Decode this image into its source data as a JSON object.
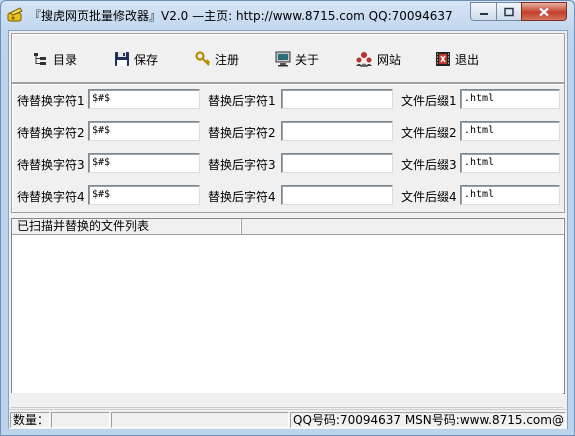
{
  "window": {
    "title": "『搜虎网页批量修改器』V2.0 —主页: http://www.8715.com QQ:70094637"
  },
  "toolbar": {
    "items": [
      {
        "label": "目录",
        "icon": "folder-tree-icon"
      },
      {
        "label": "保存",
        "icon": "floppy-disk-icon"
      },
      {
        "label": "注册",
        "icon": "key-icon"
      },
      {
        "label": "关于",
        "icon": "computer-monitor-icon"
      },
      {
        "label": "网站",
        "icon": "people-network-icon"
      },
      {
        "label": "退出",
        "icon": "exit-film-icon"
      }
    ]
  },
  "form": {
    "rows": [
      {
        "find_label": "待替换字符1",
        "find_value": "$#$",
        "replace_label": "替换后字符1",
        "replace_value": "",
        "ext_label": "文件后缀1",
        "ext_value": ".html"
      },
      {
        "find_label": "待替换字符2",
        "find_value": "$#$",
        "replace_label": "替换后字符2",
        "replace_value": "",
        "ext_label": "文件后缀2",
        "ext_value": ".html"
      },
      {
        "find_label": "待替换字符3",
        "find_value": "$#$",
        "replace_label": "替换后字符3",
        "replace_value": "",
        "ext_label": "文件后缀3",
        "ext_value": ".html"
      },
      {
        "find_label": "待替换字符4",
        "find_value": "$#$",
        "replace_label": "替换后字符4",
        "replace_value": "",
        "ext_label": "文件后缀4",
        "ext_value": ".html"
      }
    ]
  },
  "file_list": {
    "columns": [
      "已扫描并替换的文件列表",
      ""
    ]
  },
  "statusbar": {
    "count_label": "数量：",
    "count_value": "",
    "info": "QQ号码:70094637 MSN号码:www.8715.com@"
  }
}
